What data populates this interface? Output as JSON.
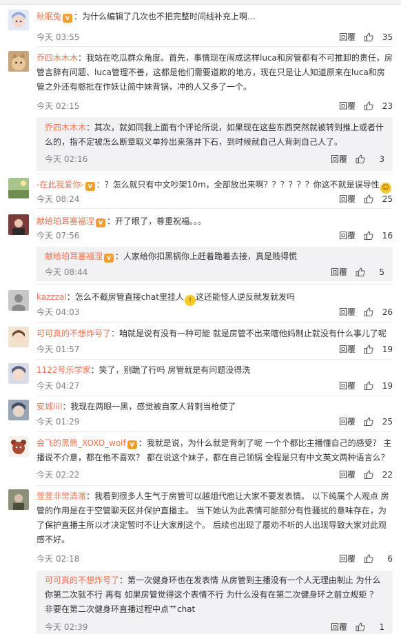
{
  "reply_label": "回覆",
  "comments": [
    {
      "user": "秋眠兔",
      "text": "：为什么编辑了几次也不把完整时间线补充上啊…",
      "time": "今天 03:55",
      "likes": "35"
    },
    {
      "user": "乔四木木木",
      "text": "：我站在吃瓜群众角度。首先，事情现在闹成这样luca和房管都有不可推卸的责任，房管言辞有问题、luca管理不善，这都是他们需要道歉的地方，现在只是让人知道原来在luca和房管之外还有憨批在作妖让简中妹背锅，冲的人又多了一个。",
      "time": "今天 02:15",
      "likes": "23"
    },
    {
      "user": "乔四木木木",
      "text": "：其次，就如同我上面有个评论所说，如果现在这些东西突然就被转到推上或者什么的，指不定被怎么断章取义单拎出来落井下石，到时候就自己人背刺自己人了。",
      "time": "今天 02:16",
      "likes": "3"
    },
    {
      "user": "-在此我爱你-",
      "text": "：？怎么就只有中文吵架10m，全部放出来啊？？？？？？你这不就是误导性",
      "time": "今天 08:24",
      "likes": "25"
    },
    {
      "user": "献给珀耳塞福涅",
      "text": "：开了眼了，尊重祝福。。。",
      "time": "今天 07:56",
      "likes": "16"
    },
    {
      "user": "献给珀耳塞福涅",
      "text": "：人家给你扣黑锅你上赶着跪着去接，真是贱得慌",
      "time": "今天 08:44",
      "likes": "5"
    },
    {
      "user": "kazzzal",
      "text": "：怎么不截房管直接chat里挂人",
      "text2": "这还能怪人逆反就发就发吗",
      "time": "今天 04:03",
      "likes": "26"
    },
    {
      "user": "可可真的不想炸号了",
      "text": "：咱就是说有没有一种可能 就是房管不出来瞎他妈制止就没有什么事儿了呢",
      "time": "今天 01:57",
      "likes": "19"
    },
    {
      "user": "1122号乐学家",
      "text": "：笑了，别跪了行吗 房管就是有问题没得洗",
      "time": "今天 04:27",
      "likes": "19"
    },
    {
      "user": "安城iiii",
      "text": "：我现在两眼一黑，感觉被自家人背刺当枪使了",
      "time": "今天 01:29",
      "likes": "25"
    },
    {
      "user": "会飞的黑熊_XOXO_wolf",
      "text": "：我就是说，为什么就是背刺了呢 一个个都比主播懂自己的感受？ 主播说不介意，都在他不喜欢？ 都在说这个妹子，都在自己领锅 全程是只有中文英文两种语言么？",
      "time": "今天 02:22",
      "likes": "22"
    },
    {
      "user": "萱萱非常清澈",
      "text": "：我看到很多人生气于房管可以越俎代庖让大家不要发表情。 以下纯属个人观点 房管的作用是在于空管聊天区并保护直播主。 当下她认为此表情可能部分有性骚扰的意味存在，为了保护直播主所以才决定暂时不让大家刷这个。 后续也出现了屡劝不听的人出现导致大家对此观感不好。",
      "time": "今天 02:18",
      "likes": "6"
    },
    {
      "user": "可可真的不想炸号了",
      "text": "：第一次健身环也在发表情 从房管到主播没有一个人无理由制止 为什么你第二次就不行 再有 如果房管觉得这个表情不行 为什么没有在第二次健身环之前立规矩 ？非要在第二次健身环直播过程中点艹chat",
      "time": "今天 02:39",
      "likes": "1"
    }
  ]
}
